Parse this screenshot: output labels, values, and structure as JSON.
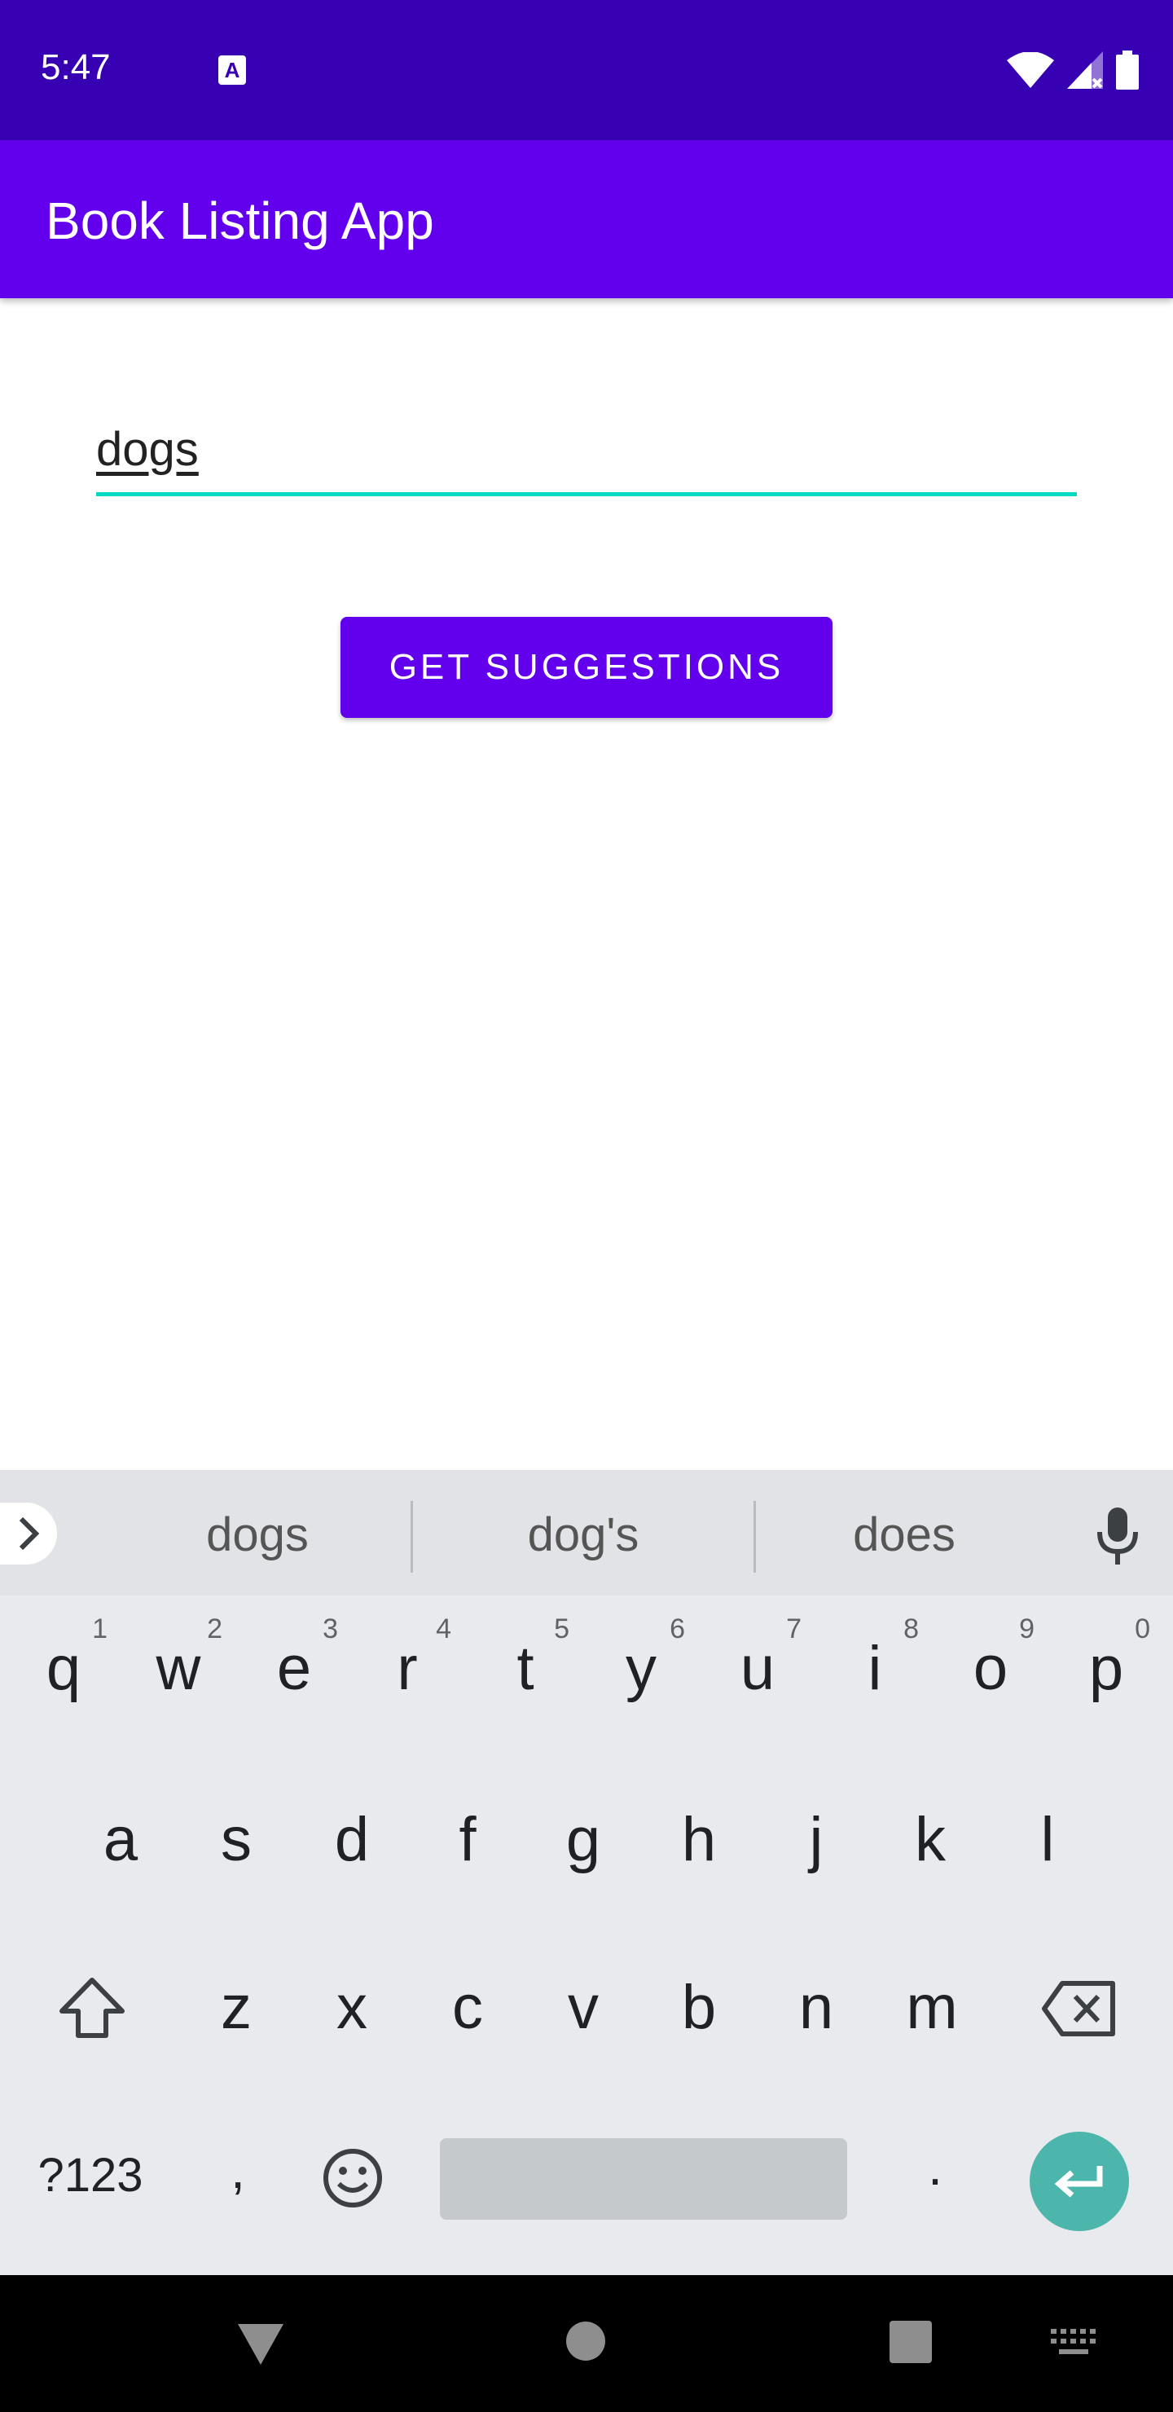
{
  "status_bar": {
    "time": "5:47",
    "notification_icon": "font-a-icon",
    "icons": [
      "wifi-icon",
      "cell-signal-icon",
      "battery-icon"
    ]
  },
  "app_bar": {
    "title": "Book Listing App"
  },
  "search": {
    "value": "dogs",
    "underline_color": "#03dac5"
  },
  "button": {
    "label": "GET SUGGESTIONS"
  },
  "colors": {
    "primary": "#6200ee",
    "primary_dark": "#3700b3",
    "accent": "#03dac5",
    "enter_key": "#4db6ac"
  },
  "keyboard": {
    "suggestions": [
      "dogs",
      "dog's",
      "does"
    ],
    "row1": [
      {
        "k": "q",
        "h": "1"
      },
      {
        "k": "w",
        "h": "2"
      },
      {
        "k": "e",
        "h": "3"
      },
      {
        "k": "r",
        "h": "4"
      },
      {
        "k": "t",
        "h": "5"
      },
      {
        "k": "y",
        "h": "6"
      },
      {
        "k": "u",
        "h": "7"
      },
      {
        "k": "i",
        "h": "8"
      },
      {
        "k": "o",
        "h": "9"
      },
      {
        "k": "p",
        "h": "0"
      }
    ],
    "row2": [
      "a",
      "s",
      "d",
      "f",
      "g",
      "h",
      "j",
      "k",
      "l"
    ],
    "row3": [
      "z",
      "x",
      "c",
      "v",
      "b",
      "n",
      "m"
    ],
    "symbols_label": "?123",
    "comma": ",",
    "period": "."
  },
  "nav_bar": {
    "icons": [
      "back-triangle-icon",
      "home-circle-icon",
      "recents-square-icon",
      "keyboard-switch-icon"
    ]
  }
}
